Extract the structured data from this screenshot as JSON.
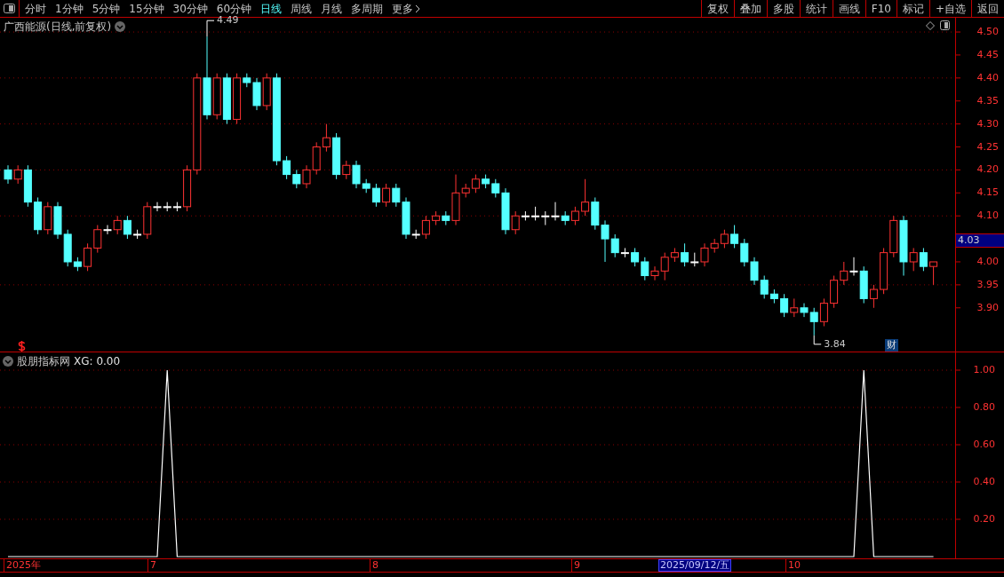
{
  "toolbar": {
    "periods": [
      {
        "label": "分时",
        "selected": false
      },
      {
        "label": "1分钟",
        "selected": false
      },
      {
        "label": "5分钟",
        "selected": false
      },
      {
        "label": "15分钟",
        "selected": false
      },
      {
        "label": "30分钟",
        "selected": false
      },
      {
        "label": "60分钟",
        "selected": false
      },
      {
        "label": "日线",
        "selected": true
      },
      {
        "label": "周线",
        "selected": false
      },
      {
        "label": "月线",
        "selected": false
      },
      {
        "label": "多周期",
        "selected": false
      }
    ],
    "more": "更多",
    "actions": [
      "复权",
      "叠加",
      "多股",
      "统计",
      "画线",
      "F10",
      "标记",
      "+自选",
      "返回"
    ]
  },
  "main_chart": {
    "title": "广西能源(日线,前复权)",
    "current_price": "4.03",
    "high_marker": "4.49",
    "low_marker": "3.84",
    "finance_badge": "财",
    "chart_data": {
      "type": "candlestick",
      "ohlc": [
        [
          4.2,
          4.21,
          4.17,
          4.18
        ],
        [
          4.18,
          4.21,
          4.17,
          4.2
        ],
        [
          4.2,
          4.21,
          4.12,
          4.13
        ],
        [
          4.13,
          4.14,
          4.06,
          4.07
        ],
        [
          4.07,
          4.13,
          4.06,
          4.12
        ],
        [
          4.12,
          4.13,
          4.05,
          4.06
        ],
        [
          4.06,
          4.07,
          3.99,
          4.0
        ],
        [
          4.0,
          4.01,
          3.98,
          3.99
        ],
        [
          3.99,
          4.04,
          3.98,
          4.03
        ],
        [
          4.03,
          4.08,
          4.02,
          4.07
        ],
        [
          4.07,
          4.08,
          4.06,
          4.07
        ],
        [
          4.07,
          4.1,
          4.06,
          4.09
        ],
        [
          4.09,
          4.1,
          4.05,
          4.06
        ],
        [
          4.06,
          4.07,
          4.05,
          4.06
        ],
        [
          4.06,
          4.13,
          4.05,
          4.12
        ],
        [
          4.12,
          4.13,
          4.11,
          4.12
        ],
        [
          4.12,
          4.13,
          4.11,
          4.12
        ],
        [
          4.12,
          4.13,
          4.11,
          4.12
        ],
        [
          4.12,
          4.21,
          4.11,
          4.2
        ],
        [
          4.2,
          4.41,
          4.19,
          4.4
        ],
        [
          4.4,
          4.49,
          4.31,
          4.32
        ],
        [
          4.32,
          4.41,
          4.31,
          4.4
        ],
        [
          4.4,
          4.41,
          4.3,
          4.31
        ],
        [
          4.31,
          4.41,
          4.3,
          4.4
        ],
        [
          4.4,
          4.41,
          4.38,
          4.39
        ],
        [
          4.39,
          4.4,
          4.33,
          4.34
        ],
        [
          4.34,
          4.41,
          4.33,
          4.4
        ],
        [
          4.4,
          4.41,
          4.21,
          4.22
        ],
        [
          4.22,
          4.23,
          4.18,
          4.19
        ],
        [
          4.19,
          4.2,
          4.16,
          4.17
        ],
        [
          4.17,
          4.21,
          4.16,
          4.2
        ],
        [
          4.2,
          4.26,
          4.19,
          4.25
        ],
        [
          4.25,
          4.3,
          4.24,
          4.27
        ],
        [
          4.27,
          4.28,
          4.18,
          4.19
        ],
        [
          4.19,
          4.22,
          4.18,
          4.21
        ],
        [
          4.21,
          4.22,
          4.16,
          4.17
        ],
        [
          4.17,
          4.18,
          4.15,
          4.16
        ],
        [
          4.16,
          4.17,
          4.12,
          4.13
        ],
        [
          4.13,
          4.17,
          4.12,
          4.16
        ],
        [
          4.16,
          4.17,
          4.12,
          4.13
        ],
        [
          4.13,
          4.14,
          4.05,
          4.06
        ],
        [
          4.06,
          4.07,
          4.05,
          4.06
        ],
        [
          4.06,
          4.1,
          4.05,
          4.09
        ],
        [
          4.09,
          4.11,
          4.08,
          4.1
        ],
        [
          4.1,
          4.11,
          4.08,
          4.09
        ],
        [
          4.09,
          4.19,
          4.08,
          4.15
        ],
        [
          4.15,
          4.17,
          4.14,
          4.16
        ],
        [
          4.16,
          4.19,
          4.15,
          4.18
        ],
        [
          4.18,
          4.19,
          4.16,
          4.17
        ],
        [
          4.17,
          4.18,
          4.14,
          4.15
        ],
        [
          4.15,
          4.16,
          4.06,
          4.07
        ],
        [
          4.07,
          4.11,
          4.06,
          4.1
        ],
        [
          4.1,
          4.11,
          4.09,
          4.1
        ],
        [
          4.1,
          4.12,
          4.09,
          4.1
        ],
        [
          4.1,
          4.11,
          4.08,
          4.1
        ],
        [
          4.1,
          4.13,
          4.09,
          4.1
        ],
        [
          4.1,
          4.11,
          4.08,
          4.09
        ],
        [
          4.09,
          4.12,
          4.08,
          4.11
        ],
        [
          4.11,
          4.18,
          4.1,
          4.13
        ],
        [
          4.13,
          4.14,
          4.07,
          4.08
        ],
        [
          4.08,
          4.09,
          4.0,
          4.05
        ],
        [
          4.05,
          4.06,
          4.01,
          4.02
        ],
        [
          4.02,
          4.03,
          4.01,
          4.02
        ],
        [
          4.02,
          4.03,
          3.99,
          4.0
        ],
        [
          4.0,
          4.01,
          3.96,
          3.97
        ],
        [
          3.97,
          3.99,
          3.96,
          3.98
        ],
        [
          3.98,
          4.02,
          3.96,
          4.01
        ],
        [
          4.01,
          4.03,
          4.0,
          4.02
        ],
        [
          4.02,
          4.04,
          3.99,
          4.0
        ],
        [
          4.0,
          4.02,
          3.99,
          4.0
        ],
        [
          4.0,
          4.04,
          3.99,
          4.03
        ],
        [
          4.03,
          4.05,
          4.02,
          4.04
        ],
        [
          4.04,
          4.07,
          4.03,
          4.06
        ],
        [
          4.06,
          4.08,
          4.03,
          4.04
        ],
        [
          4.04,
          4.05,
          3.99,
          4.0
        ],
        [
          4.0,
          4.01,
          3.95,
          3.96
        ],
        [
          3.96,
          3.97,
          3.92,
          3.93
        ],
        [
          3.93,
          3.94,
          3.91,
          3.92
        ],
        [
          3.92,
          3.93,
          3.88,
          3.89
        ],
        [
          3.89,
          3.92,
          3.88,
          3.9
        ],
        [
          3.9,
          3.91,
          3.88,
          3.89
        ],
        [
          3.89,
          3.9,
          3.84,
          3.87
        ],
        [
          3.87,
          3.92,
          3.86,
          3.91
        ],
        [
          3.91,
          3.97,
          3.9,
          3.96
        ],
        [
          3.96,
          4.0,
          3.95,
          3.98
        ],
        [
          3.98,
          4.01,
          3.97,
          3.98
        ],
        [
          3.98,
          3.99,
          3.91,
          3.92
        ],
        [
          3.92,
          3.95,
          3.9,
          3.94
        ],
        [
          3.94,
          4.03,
          3.93,
          4.02
        ],
        [
          4.02,
          4.1,
          4.01,
          4.09
        ],
        [
          4.09,
          4.1,
          3.97,
          4.0
        ],
        [
          4.0,
          4.03,
          3.98,
          4.02
        ],
        [
          4.02,
          4.03,
          3.98,
          3.99
        ],
        [
          3.99,
          4.0,
          3.95,
          4.0
        ]
      ],
      "grid": true,
      "ylim": [
        3.803,
        4.531
      ],
      "yticks": [
        {
          "value": 4.5,
          "label": "4.50"
        },
        {
          "value": 4.45,
          "label": "4.45"
        },
        {
          "value": 4.4,
          "label": "4.40"
        },
        {
          "value": 4.35,
          "label": "4.35"
        },
        {
          "value": 4.3,
          "label": "4.30"
        },
        {
          "value": 4.25,
          "label": "4.25"
        },
        {
          "value": 4.2,
          "label": "4.20"
        },
        {
          "value": 4.15,
          "label": "4.15"
        },
        {
          "value": 4.1,
          "label": "4.10"
        },
        {
          "value": 4.0,
          "label": "4.00"
        },
        {
          "value": 3.95,
          "label": "3.95"
        },
        {
          "value": 3.9,
          "label": "3.90"
        }
      ]
    }
  },
  "indicator": {
    "name": "股朋指标网",
    "reading": "XG: 0.00",
    "chart_data": {
      "type": "line",
      "series": [
        {
          "color": "#ffffff",
          "values": [
            0,
            0,
            0,
            0,
            0,
            0,
            0,
            0,
            0,
            0,
            0,
            0,
            0,
            0,
            0,
            0,
            1,
            0,
            0,
            0,
            0,
            0,
            0,
            0,
            0,
            0,
            0,
            0,
            0,
            0,
            0,
            0,
            0,
            0,
            0,
            0,
            0,
            0,
            0,
            0,
            0,
            0,
            0,
            0,
            0,
            0,
            0,
            0,
            0,
            0,
            0,
            0,
            0,
            0,
            0,
            0,
            0,
            0,
            0,
            0,
            0,
            0,
            0,
            0,
            0,
            0,
            0,
            0,
            0,
            0,
            0,
            0,
            0,
            0,
            0,
            0,
            0,
            0,
            0,
            0,
            0,
            0,
            0,
            0,
            0,
            0,
            1,
            0,
            0,
            0,
            0,
            0,
            0,
            0
          ]
        }
      ],
      "ylim": [
        0,
        1
      ],
      "grid": true,
      "yticks": [
        {
          "value": 0.2,
          "label": "0.20"
        },
        {
          "value": 0.4,
          "label": "0.40"
        },
        {
          "value": 0.6,
          "label": "0.60"
        },
        {
          "value": 0.8,
          "label": "0.80"
        },
        {
          "value": 1,
          "label": "1.00"
        }
      ]
    }
  },
  "date_axis": [
    {
      "label": "2025年",
      "selected": false
    },
    {
      "label": "7",
      "selected": false
    },
    {
      "label": "8",
      "selected": false
    },
    {
      "label": "9",
      "selected": false
    },
    {
      "label": "2025/09/12/五",
      "selected": true
    },
    {
      "label": "10",
      "selected": false
    }
  ]
}
